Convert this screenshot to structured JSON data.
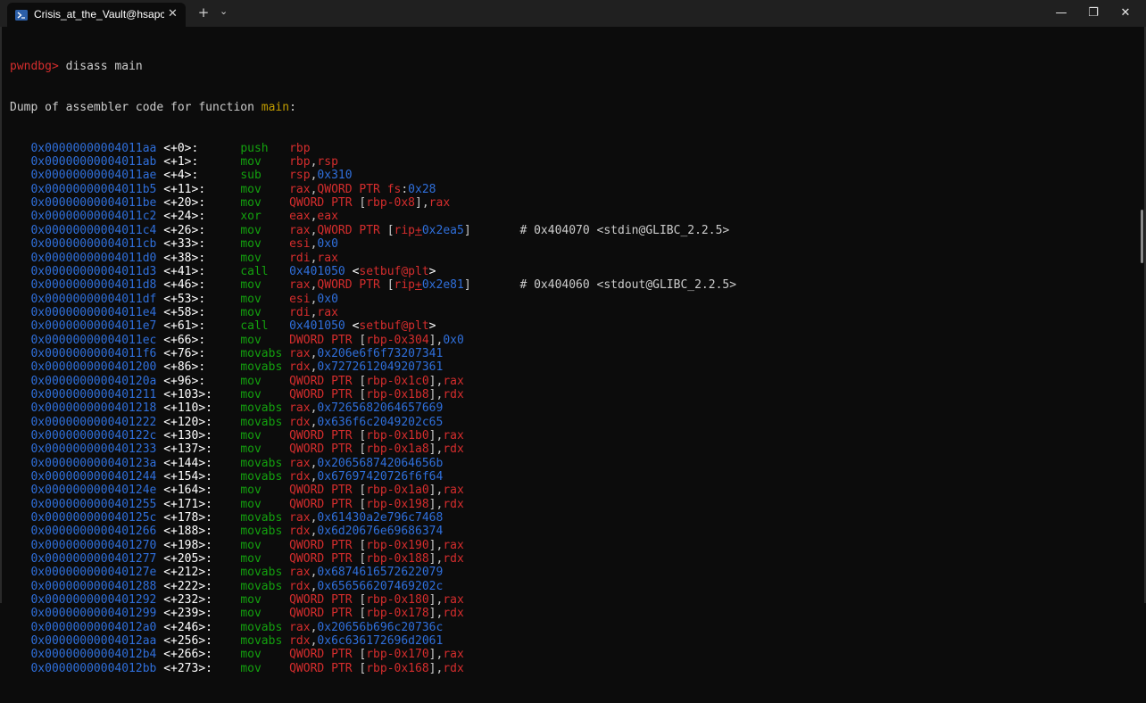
{
  "window": {
    "tab_title": "Crisis_at_the_Vault@hsapce-ic",
    "tab_close": "✕",
    "new_tab": "+",
    "dropdown": "⌄",
    "minimize": "—",
    "maximize": "❐",
    "close": "✕",
    "icon": "powershell-icon"
  },
  "terminal": {
    "prompt": "pwndbg>",
    "command": " disass main",
    "dump_prefix": "Dump of assembler code for function ",
    "dump_func": "main",
    "dump_suffix": ":",
    "lines": [
      {
        "addr": "0x00000000004011aa",
        "off": "<+0>:",
        "mn": "push",
        "ops": [
          [
            "rg",
            "rbp"
          ]
        ]
      },
      {
        "addr": "0x00000000004011ab",
        "off": "<+1>:",
        "mn": "mov",
        "ops": [
          [
            "rg",
            "rbp"
          ],
          [
            "plain",
            ","
          ],
          [
            "rg",
            "rsp"
          ]
        ]
      },
      {
        "addr": "0x00000000004011ae",
        "off": "<+4>:",
        "mn": "sub",
        "ops": [
          [
            "rg",
            "rsp"
          ],
          [
            "plain",
            ","
          ],
          [
            "nm",
            "0x310"
          ]
        ]
      },
      {
        "addr": "0x00000000004011b5",
        "off": "<+11>:",
        "mn": "mov",
        "ops": [
          [
            "rg",
            "rax"
          ],
          [
            "plain",
            ","
          ],
          [
            "rg",
            "QWORD PTR fs"
          ],
          [
            "plain",
            ":"
          ],
          [
            "nm",
            "0x28"
          ]
        ]
      },
      {
        "addr": "0x00000000004011be",
        "off": "<+20>:",
        "mn": "mov",
        "ops": [
          [
            "rg",
            "QWORD PTR "
          ],
          [
            "plain",
            "["
          ],
          [
            "rg",
            "rbp-0x8"
          ],
          [
            "plain",
            "]"
          ],
          [
            "plain",
            ","
          ],
          [
            "rg",
            "rax"
          ]
        ]
      },
      {
        "addr": "0x00000000004011c2",
        "off": "<+24>:",
        "mn": "xor",
        "ops": [
          [
            "rg",
            "eax"
          ],
          [
            "plain",
            ","
          ],
          [
            "rg",
            "eax"
          ]
        ]
      },
      {
        "addr": "0x00000000004011c4",
        "off": "<+26>:",
        "mn": "mov",
        "ops": [
          [
            "rg",
            "rax"
          ],
          [
            "plain",
            ","
          ],
          [
            "rg",
            "QWORD PTR "
          ],
          [
            "plain",
            "["
          ],
          [
            "rg",
            "rip"
          ],
          [
            "ul",
            "+"
          ],
          [
            "nm",
            "0x2ea5"
          ],
          [
            "plain",
            "]"
          ]
        ],
        "comment": "# 0x404070 <stdin@GLIBC_2.2.5>"
      },
      {
        "addr": "0x00000000004011cb",
        "off": "<+33>:",
        "mn": "mov",
        "ops": [
          [
            "rg",
            "esi"
          ],
          [
            "plain",
            ","
          ],
          [
            "nm",
            "0x0"
          ]
        ]
      },
      {
        "addr": "0x00000000004011d0",
        "off": "<+38>:",
        "mn": "mov",
        "ops": [
          [
            "rg",
            "rdi"
          ],
          [
            "plain",
            ","
          ],
          [
            "rg",
            "rax"
          ]
        ]
      },
      {
        "addr": "0x00000000004011d3",
        "off": "<+41>:",
        "mn": "call",
        "ops": [
          [
            "nm",
            "0x401050"
          ],
          [
            "plain",
            " "
          ],
          [
            "sym",
            "<"
          ],
          [
            "rg",
            "setbuf@plt"
          ],
          [
            "sym",
            ">"
          ]
        ]
      },
      {
        "addr": "0x00000000004011d8",
        "off": "<+46>:",
        "mn": "mov",
        "ops": [
          [
            "rg",
            "rax"
          ],
          [
            "plain",
            ","
          ],
          [
            "rg",
            "QWORD PTR "
          ],
          [
            "plain",
            "["
          ],
          [
            "rg",
            "rip"
          ],
          [
            "ul",
            "+"
          ],
          [
            "nm",
            "0x2e81"
          ],
          [
            "plain",
            "]"
          ]
        ],
        "comment": "# 0x404060 <stdout@GLIBC_2.2.5>"
      },
      {
        "addr": "0x00000000004011df",
        "off": "<+53>:",
        "mn": "mov",
        "ops": [
          [
            "rg",
            "esi"
          ],
          [
            "plain",
            ","
          ],
          [
            "nm",
            "0x0"
          ]
        ]
      },
      {
        "addr": "0x00000000004011e4",
        "off": "<+58>:",
        "mn": "mov",
        "ops": [
          [
            "rg",
            "rdi"
          ],
          [
            "plain",
            ","
          ],
          [
            "rg",
            "rax"
          ]
        ]
      },
      {
        "addr": "0x00000000004011e7",
        "off": "<+61>:",
        "mn": "call",
        "ops": [
          [
            "nm",
            "0x401050"
          ],
          [
            "plain",
            " "
          ],
          [
            "sym",
            "<"
          ],
          [
            "rg",
            "setbuf@plt"
          ],
          [
            "sym",
            ">"
          ]
        ]
      },
      {
        "addr": "0x00000000004011ec",
        "off": "<+66>:",
        "mn": "mov",
        "ops": [
          [
            "rg",
            "DWORD PTR "
          ],
          [
            "plain",
            "["
          ],
          [
            "rg",
            "rbp-0x304"
          ],
          [
            "plain",
            "]"
          ],
          [
            "plain",
            ","
          ],
          [
            "nm",
            "0x0"
          ]
        ]
      },
      {
        "addr": "0x00000000004011f6",
        "off": "<+76>:",
        "mn": "movabs",
        "ops": [
          [
            "rg",
            "rax"
          ],
          [
            "plain",
            ","
          ],
          [
            "nm",
            "0x206e6f6f73207341"
          ]
        ]
      },
      {
        "addr": "0x0000000000401200",
        "off": "<+86>:",
        "mn": "movabs",
        "ops": [
          [
            "rg",
            "rdx"
          ],
          [
            "plain",
            ","
          ],
          [
            "nm",
            "0x7272612049207361"
          ]
        ]
      },
      {
        "addr": "0x000000000040120a",
        "off": "<+96>:",
        "mn": "mov",
        "ops": [
          [
            "rg",
            "QWORD PTR "
          ],
          [
            "plain",
            "["
          ],
          [
            "rg",
            "rbp-0x1c0"
          ],
          [
            "plain",
            "]"
          ],
          [
            "plain",
            ","
          ],
          [
            "rg",
            "rax"
          ]
        ]
      },
      {
        "addr": "0x0000000000401211",
        "off": "<+103>:",
        "mn": "mov",
        "ops": [
          [
            "rg",
            "QWORD PTR "
          ],
          [
            "plain",
            "["
          ],
          [
            "rg",
            "rbp-0x1b8"
          ],
          [
            "plain",
            "]"
          ],
          [
            "plain",
            ","
          ],
          [
            "rg",
            "rdx"
          ]
        ]
      },
      {
        "addr": "0x0000000000401218",
        "off": "<+110>:",
        "mn": "movabs",
        "ops": [
          [
            "rg",
            "rax"
          ],
          [
            "plain",
            ","
          ],
          [
            "nm",
            "0x7265682064657669"
          ]
        ]
      },
      {
        "addr": "0x0000000000401222",
        "off": "<+120>:",
        "mn": "movabs",
        "ops": [
          [
            "rg",
            "rdx"
          ],
          [
            "plain",
            ","
          ],
          [
            "nm",
            "0x636f6c2049202c65"
          ]
        ]
      },
      {
        "addr": "0x000000000040122c",
        "off": "<+130>:",
        "mn": "mov",
        "ops": [
          [
            "rg",
            "QWORD PTR "
          ],
          [
            "plain",
            "["
          ],
          [
            "rg",
            "rbp-0x1b0"
          ],
          [
            "plain",
            "]"
          ],
          [
            "plain",
            ","
          ],
          [
            "rg",
            "rax"
          ]
        ]
      },
      {
        "addr": "0x0000000000401233",
        "off": "<+137>:",
        "mn": "mov",
        "ops": [
          [
            "rg",
            "QWORD PTR "
          ],
          [
            "plain",
            "["
          ],
          [
            "rg",
            "rbp-0x1a8"
          ],
          [
            "plain",
            "]"
          ],
          [
            "plain",
            ","
          ],
          [
            "rg",
            "rdx"
          ]
        ]
      },
      {
        "addr": "0x000000000040123a",
        "off": "<+144>:",
        "mn": "movabs",
        "ops": [
          [
            "rg",
            "rax"
          ],
          [
            "plain",
            ","
          ],
          [
            "nm",
            "0x206568742064656b"
          ]
        ]
      },
      {
        "addr": "0x0000000000401244",
        "off": "<+154>:",
        "mn": "movabs",
        "ops": [
          [
            "rg",
            "rdx"
          ],
          [
            "plain",
            ","
          ],
          [
            "nm",
            "0x67697420726f6f64"
          ]
        ]
      },
      {
        "addr": "0x000000000040124e",
        "off": "<+164>:",
        "mn": "mov",
        "ops": [
          [
            "rg",
            "QWORD PTR "
          ],
          [
            "plain",
            "["
          ],
          [
            "rg",
            "rbp-0x1a0"
          ],
          [
            "plain",
            "]"
          ],
          [
            "plain",
            ","
          ],
          [
            "rg",
            "rax"
          ]
        ]
      },
      {
        "addr": "0x0000000000401255",
        "off": "<+171>:",
        "mn": "mov",
        "ops": [
          [
            "rg",
            "QWORD PTR "
          ],
          [
            "plain",
            "["
          ],
          [
            "rg",
            "rbp-0x198"
          ],
          [
            "plain",
            "]"
          ],
          [
            "plain",
            ","
          ],
          [
            "rg",
            "rdx"
          ]
        ]
      },
      {
        "addr": "0x000000000040125c",
        "off": "<+178>:",
        "mn": "movabs",
        "ops": [
          [
            "rg",
            "rax"
          ],
          [
            "plain",
            ","
          ],
          [
            "nm",
            "0x61430a2e796c7468"
          ]
        ]
      },
      {
        "addr": "0x0000000000401266",
        "off": "<+188>:",
        "mn": "movabs",
        "ops": [
          [
            "rg",
            "rdx"
          ],
          [
            "plain",
            ","
          ],
          [
            "nm",
            "0x6d20676e69686374"
          ]
        ]
      },
      {
        "addr": "0x0000000000401270",
        "off": "<+198>:",
        "mn": "mov",
        "ops": [
          [
            "rg",
            "QWORD PTR "
          ],
          [
            "plain",
            "["
          ],
          [
            "rg",
            "rbp-0x190"
          ],
          [
            "plain",
            "]"
          ],
          [
            "plain",
            ","
          ],
          [
            "rg",
            "rax"
          ]
        ]
      },
      {
        "addr": "0x0000000000401277",
        "off": "<+205>:",
        "mn": "mov",
        "ops": [
          [
            "rg",
            "QWORD PTR "
          ],
          [
            "plain",
            "["
          ],
          [
            "rg",
            "rbp-0x188"
          ],
          [
            "plain",
            "]"
          ],
          [
            "plain",
            ","
          ],
          [
            "rg",
            "rdx"
          ]
        ]
      },
      {
        "addr": "0x000000000040127e",
        "off": "<+212>:",
        "mn": "movabs",
        "ops": [
          [
            "rg",
            "rax"
          ],
          [
            "plain",
            ","
          ],
          [
            "nm",
            "0x6874616572622079"
          ]
        ]
      },
      {
        "addr": "0x0000000000401288",
        "off": "<+222>:",
        "mn": "movabs",
        "ops": [
          [
            "rg",
            "rdx"
          ],
          [
            "plain",
            ","
          ],
          [
            "nm",
            "0x656566207469202c"
          ]
        ]
      },
      {
        "addr": "0x0000000000401292",
        "off": "<+232>:",
        "mn": "mov",
        "ops": [
          [
            "rg",
            "QWORD PTR "
          ],
          [
            "plain",
            "["
          ],
          [
            "rg",
            "rbp-0x180"
          ],
          [
            "plain",
            "]"
          ],
          [
            "plain",
            ","
          ],
          [
            "rg",
            "rax"
          ]
        ]
      },
      {
        "addr": "0x0000000000401299",
        "off": "<+239>:",
        "mn": "mov",
        "ops": [
          [
            "rg",
            "QWORD PTR "
          ],
          [
            "plain",
            "["
          ],
          [
            "rg",
            "rbp-0x178"
          ],
          [
            "plain",
            "]"
          ],
          [
            "plain",
            ","
          ],
          [
            "rg",
            "rdx"
          ]
        ]
      },
      {
        "addr": "0x00000000004012a0",
        "off": "<+246>:",
        "mn": "movabs",
        "ops": [
          [
            "rg",
            "rax"
          ],
          [
            "plain",
            ","
          ],
          [
            "nm",
            "0x20656b696c20736c"
          ]
        ]
      },
      {
        "addr": "0x00000000004012aa",
        "off": "<+256>:",
        "mn": "movabs",
        "ops": [
          [
            "rg",
            "rdx"
          ],
          [
            "plain",
            ","
          ],
          [
            "nm",
            "0x6c636172696d2061"
          ]
        ]
      },
      {
        "addr": "0x00000000004012b4",
        "off": "<+266>:",
        "mn": "mov",
        "ops": [
          [
            "rg",
            "QWORD PTR "
          ],
          [
            "plain",
            "["
          ],
          [
            "rg",
            "rbp-0x170"
          ],
          [
            "plain",
            "]"
          ],
          [
            "plain",
            ","
          ],
          [
            "rg",
            "rax"
          ]
        ]
      },
      {
        "addr": "0x00000000004012bb",
        "off": "<+273>:",
        "mn": "mov",
        "ops": [
          [
            "rg",
            "QWORD PTR "
          ],
          [
            "plain",
            "["
          ],
          [
            "rg",
            "rbp-0x168"
          ],
          [
            "plain",
            "]"
          ],
          [
            "plain",
            ","
          ],
          [
            "rg",
            "rdx"
          ]
        ]
      }
    ]
  },
  "colors": {
    "background": "#0c0c0c",
    "address": "#2f6fdb",
    "mnemonic": "#13a10e",
    "register": "#d52d2d",
    "number": "#2f6fdb",
    "function_name": "#c19c00"
  }
}
